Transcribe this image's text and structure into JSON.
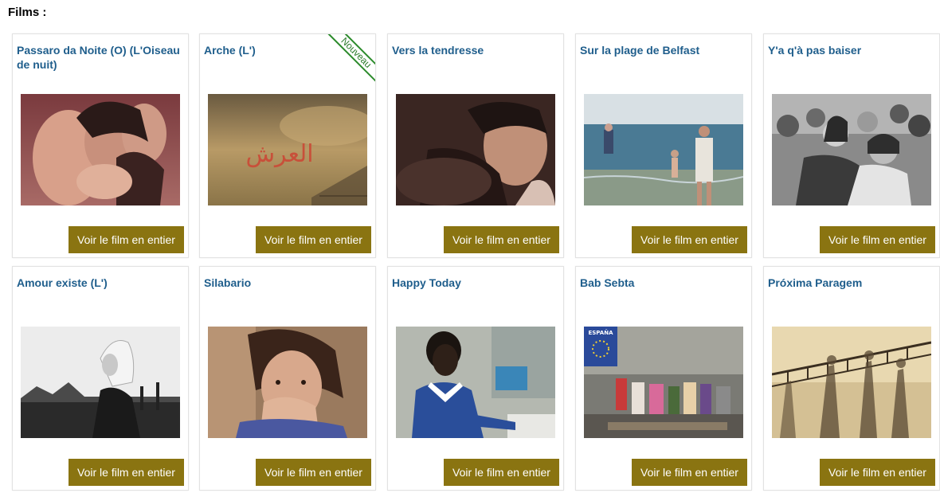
{
  "section": {
    "title": "Films :"
  },
  "films": [
    {
      "title": "Passaro da Noite (O) (L'Oiseau de nuit)",
      "button": "Voir le film en entier",
      "badge": ""
    },
    {
      "title": "Arche (L')",
      "button": "Voir le film en entier",
      "badge": "Nouveau"
    },
    {
      "title": "Vers la tendresse",
      "button": "Voir le film en entier",
      "badge": ""
    },
    {
      "title": "Sur la plage de Belfast",
      "button": "Voir le film en entier",
      "badge": ""
    },
    {
      "title": "Y'a q'à pas baiser",
      "button": "Voir le film en entier",
      "badge": ""
    },
    {
      "title": "Amour existe (L')",
      "button": "Voir le film en entier",
      "badge": ""
    },
    {
      "title": "Silabario",
      "button": "Voir le film en entier",
      "badge": ""
    },
    {
      "title": "Happy Today",
      "button": "Voir le film en entier",
      "badge": ""
    },
    {
      "title": "Bab Sebta",
      "button": "Voir le film en entier",
      "badge": ""
    },
    {
      "title": "Próxima Paragem",
      "button": "Voir le film en entier",
      "badge": ""
    }
  ],
  "image_texts": {
    "arche_arabic": "العرش",
    "bab_sebta_sign": "ESPAÑA"
  },
  "colors": {
    "title": "#1f5e8c",
    "button_bg": "#8a7411",
    "button_text": "#ffffff",
    "badge_border": "#2a8a2a"
  }
}
